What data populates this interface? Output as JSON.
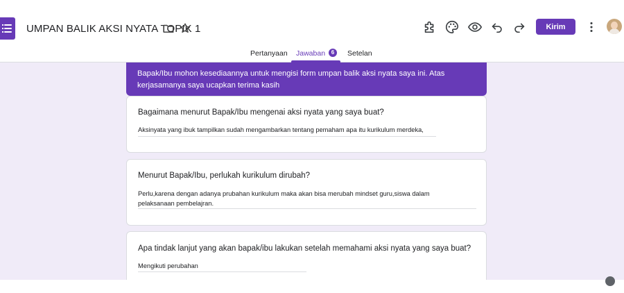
{
  "header": {
    "title": "UMPAN BALIK AKSI NYATA TOPIK 1",
    "icons": [
      "forms-app-icon",
      "folder-icon",
      "star-icon"
    ],
    "toolbar_icons": [
      "addon-puzzle-icon",
      "palette-icon",
      "preview-eye-icon",
      "undo-icon",
      "redo-icon",
      "more-vert-icon"
    ],
    "send_label": "Kirim",
    "accent_color": "#673ab7"
  },
  "tabs": [
    {
      "label": "Pertanyaan"
    },
    {
      "label": "Jawaban",
      "badge": "6",
      "active": true
    },
    {
      "label": "Setelan"
    }
  ],
  "form": {
    "description": "Bapak/Ibu mohon kesediaannya untuk mengisi form umpan balik aksi nyata saya ini. Atas kerjasamanya saya ucapkan terima kasih",
    "questions": [
      {
        "question": "Bagaimana menurut Bapak/Ibu mengenai aksi nyata yang saya buat?",
        "answer": "Aksinyata yang ibuk tampilkan sudah mengambarkan tentang pemaham apa itu kurikulum merdeka,"
      },
      {
        "question": "Menurut Bapak/Ibu, perlukah kurikulum dirubah?",
        "answer": "Perlu,karena dengan adanya prubahan kurikulum maka akan bisa merubah mindset guru,siswa dalam pelaksanaan pembelajran."
      },
      {
        "question": "Apa tindak lanjut yang akan bapak/ibu lakukan setelah memahami aksi nyata yang saya buat?",
        "answer": "Mengikuti perubahan"
      }
    ]
  }
}
